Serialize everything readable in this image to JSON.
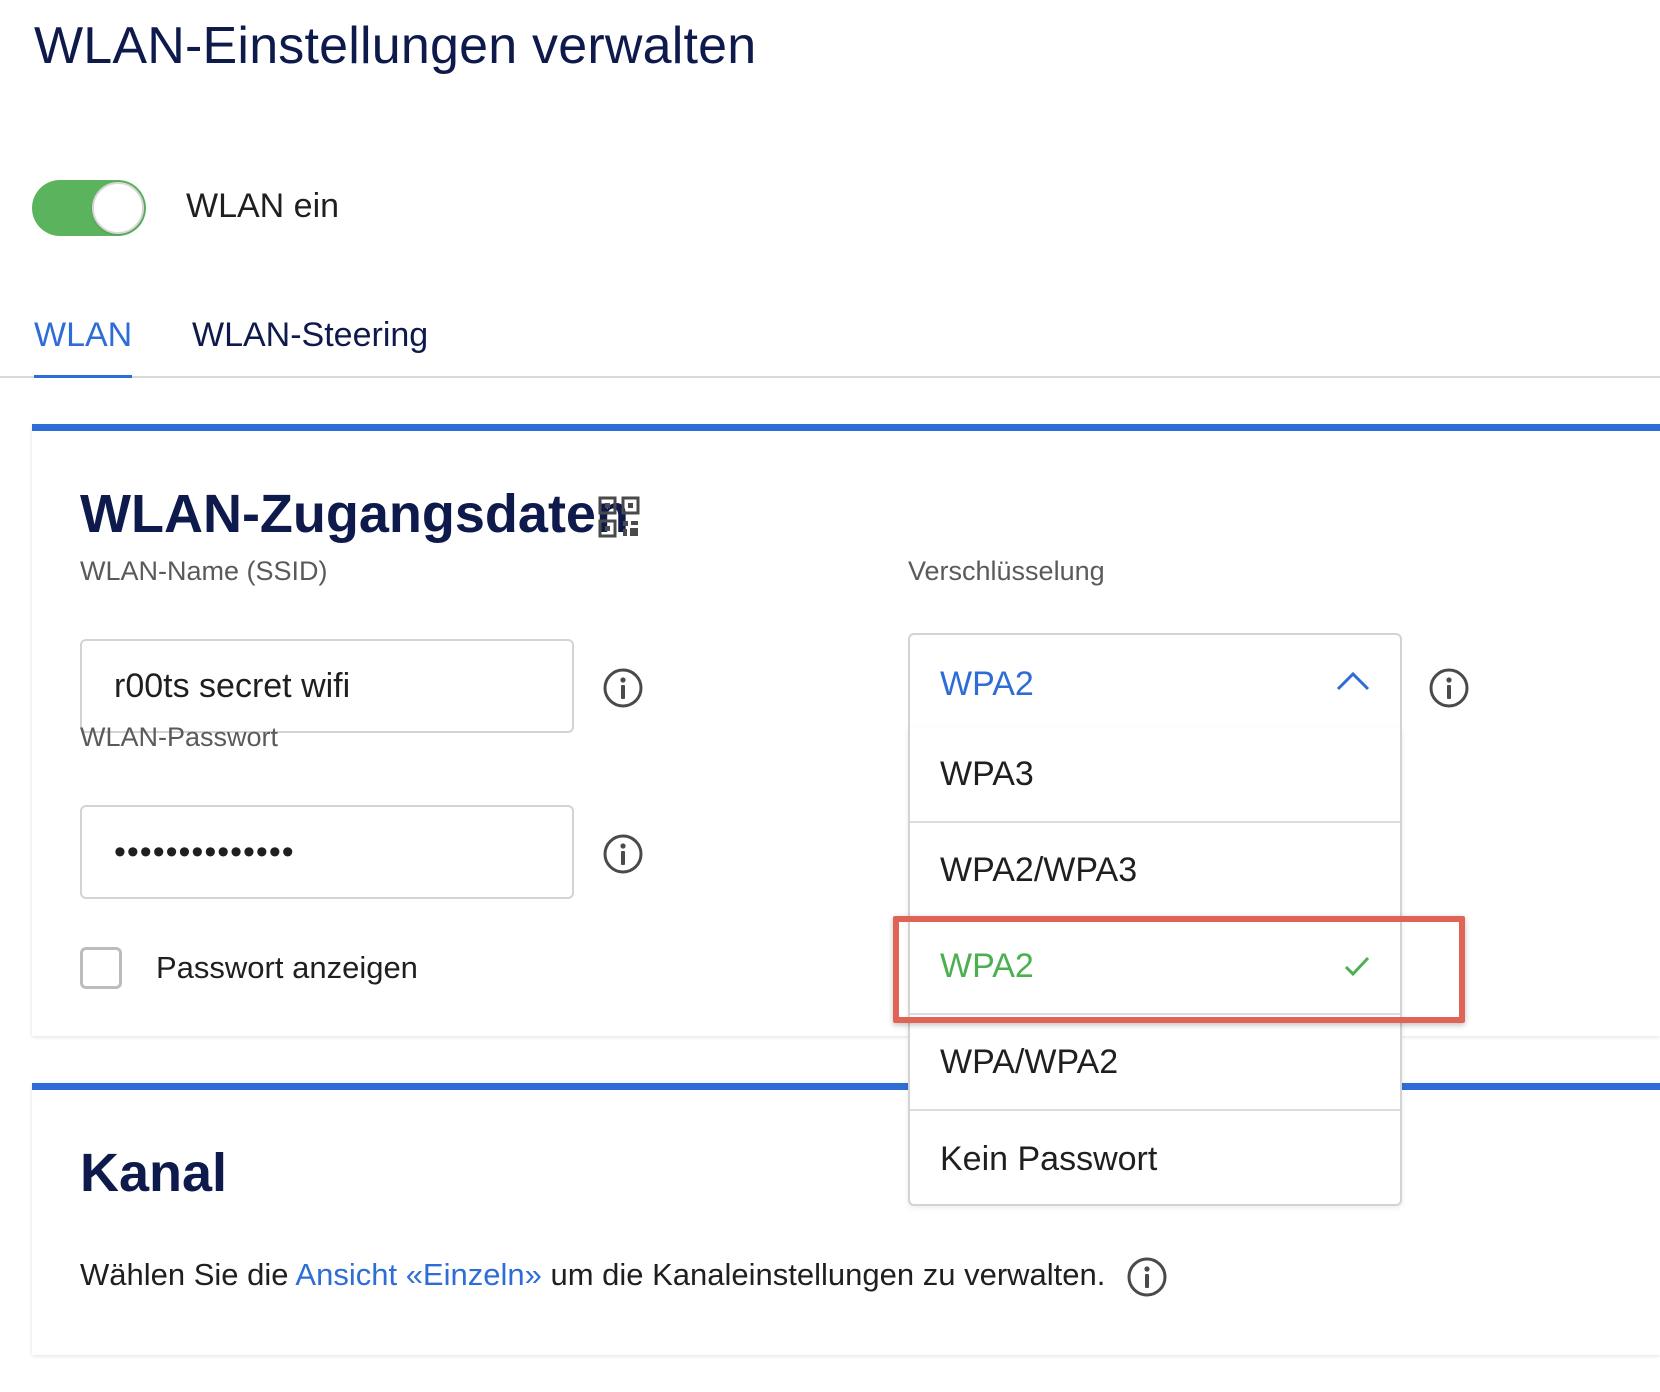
{
  "page": {
    "title": "WLAN-Einstellungen verwalten"
  },
  "toggle": {
    "label": "WLAN ein",
    "state": "on"
  },
  "tabs": [
    {
      "label": "WLAN",
      "active": true
    },
    {
      "label": "WLAN-Steering",
      "active": false
    }
  ],
  "credentials": {
    "title": "WLAN-Zugangsdaten",
    "ssid_label": "WLAN-Name (SSID)",
    "ssid_value": "r00ts secret wifi",
    "password_label": "WLAN-Passwort",
    "password_value": "••••••••••••••",
    "show_password_label": "Passwort anzeigen",
    "show_password_checked": false,
    "encryption_label": "Verschlüsselung",
    "encryption_value": "WPA2",
    "encryption_options": [
      "WPA3",
      "WPA2/WPA3",
      "WPA2",
      "WPA/WPA2",
      "Kein Passwort"
    ],
    "encryption_selected_index": 2
  },
  "kanal": {
    "title": "Kanal",
    "text_before": "Wählen Sie die ",
    "link_text": "Ansicht «Einzeln»",
    "text_after": " um die Kanaleinstellungen zu verwalten."
  },
  "icons": {
    "qr": "qr-code-icon",
    "info": "info-icon",
    "chevron": "chevron-up-icon",
    "check": "checkmark-icon"
  },
  "colors": {
    "accent": "#2f6dd6",
    "toggle_on": "#5cb35e",
    "selected_option": "#4caf50",
    "highlight": "#e06455",
    "heading": "#0d1a4b"
  }
}
